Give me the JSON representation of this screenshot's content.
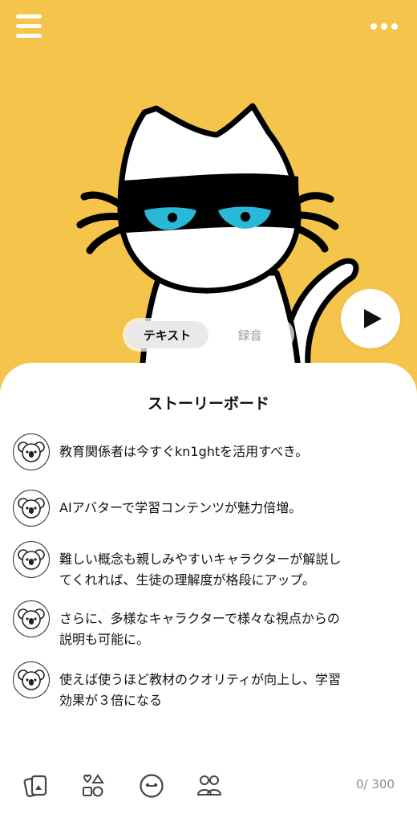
{
  "header": {
    "menu_icon": "hamburger-menu-icon",
    "more_icon": "more-dots-icon"
  },
  "hero": {
    "background": "#F4C54A",
    "character": "masked-white-cat"
  },
  "mode_toggle": {
    "options": [
      "テキスト",
      "録音"
    ],
    "selected": "テキスト"
  },
  "play_button": {
    "icon": "play-icon"
  },
  "storyboard": {
    "title": "ストーリーボード",
    "items": [
      {
        "lines": [
          "教育関係者は今すぐkn1ghtを活用すべき。"
        ]
      },
      {
        "lines": [
          "AIアバターで学習コンテンツが魅力倍増。"
        ]
      },
      {
        "lines": [
          "難しい概念も親しみやすいキャラクターが解説し",
          "てくれれば、生徒の理解度が格段にアップ。"
        ]
      },
      {
        "lines": [
          "さらに、多様なキャラクターで様々な視点からの",
          "説明も可能に。"
        ]
      },
      {
        "lines": [
          "使えば使うほど教材のクオリティが向上し、学習",
          "効果が３倍になる"
        ]
      }
    ]
  },
  "bottom_bar": {
    "tools": [
      "cards-icon",
      "shapes-icon",
      "emoji-face-icon",
      "characters-icon"
    ],
    "counter": "0/ 300"
  }
}
